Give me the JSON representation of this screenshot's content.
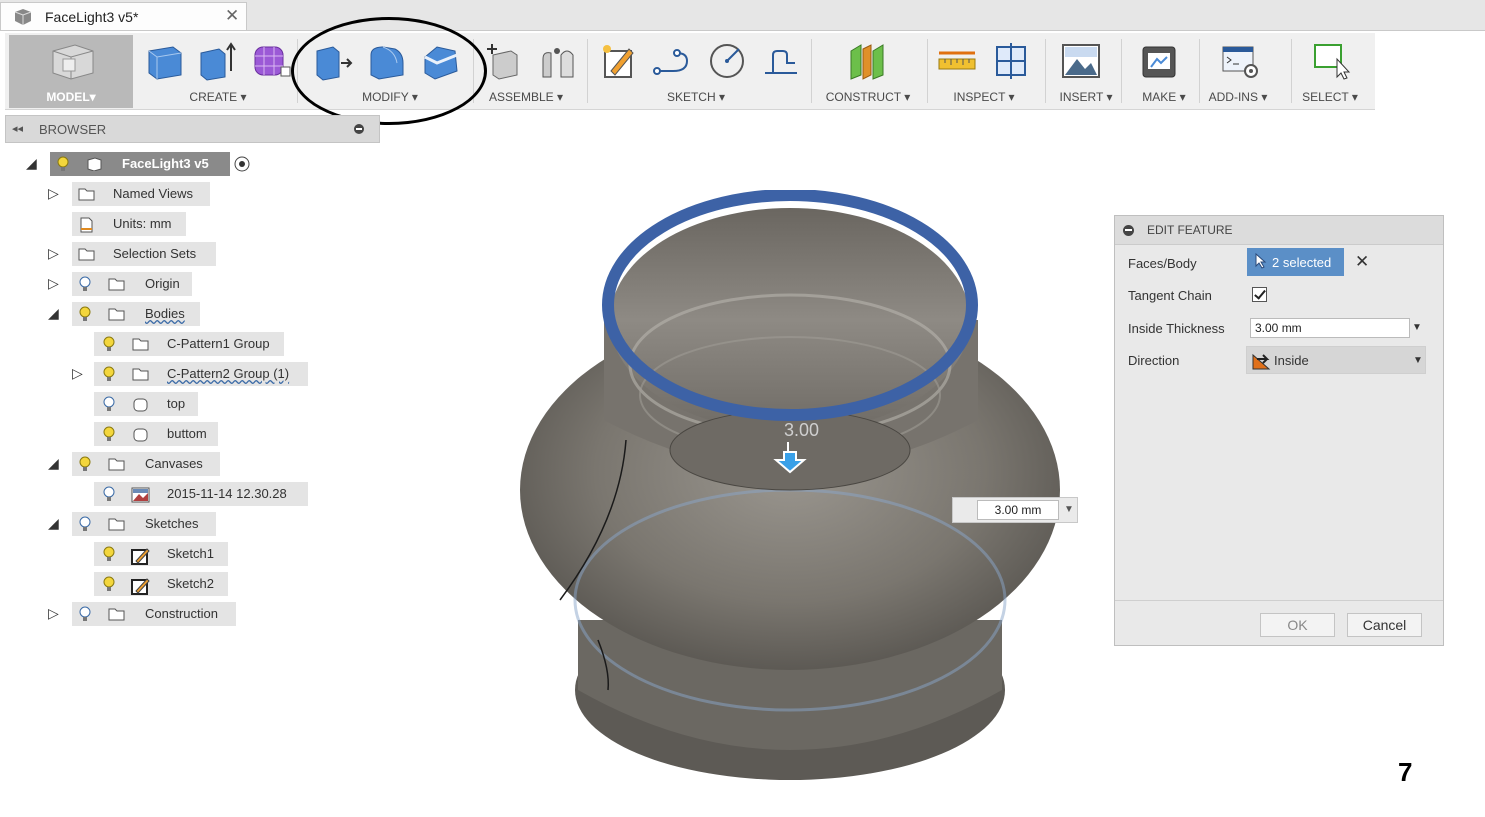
{
  "tab": {
    "title": "FaceLight3 v5*",
    "close": "✕"
  },
  "toolbar": {
    "workspace": "MODEL",
    "groups": {
      "create": "CREATE",
      "modify": "MODIFY",
      "assemble": "ASSEMBLE",
      "sketch": "SKETCH",
      "construct": "CONSTRUCT",
      "inspect": "INSPECT",
      "insert": "INSERT",
      "make": "MAKE",
      "addins": "ADD-INS",
      "select": "SELECT"
    },
    "dropdown_arrow": "▾"
  },
  "browser": {
    "title": "BROWSER",
    "collapse": "◂◂",
    "items": [
      {
        "label": "FaceLight3 v5"
      },
      {
        "label": "Named Views"
      },
      {
        "label": "Units: mm"
      },
      {
        "label": "Selection Sets"
      },
      {
        "label": "Origin"
      },
      {
        "label": "Bodies"
      },
      {
        "label": "C-Pattern1 Group"
      },
      {
        "label": "C-Pattern2 Group (1)"
      },
      {
        "label": "top"
      },
      {
        "label": "buttom"
      },
      {
        "label": "Canvases"
      },
      {
        "label": "2015-11-14 12.30.28"
      },
      {
        "label": "Sketches"
      },
      {
        "label": "Sketch1"
      },
      {
        "label": "Sketch2"
      },
      {
        "label": "Construction"
      }
    ]
  },
  "viewport": {
    "dimension_label": "3.00",
    "dimension_input": "3.00 mm"
  },
  "edit_feature": {
    "title": "EDIT FEATURE",
    "faces_label": "Faces/Body",
    "faces_value": "2 selected",
    "tangent_label": "Tangent Chain",
    "tangent_checked": true,
    "thickness_label": "Inside Thickness",
    "thickness_value": "3.00 mm",
    "direction_label": "Direction",
    "direction_value": "Inside",
    "ok": "OK",
    "cancel": "Cancel"
  },
  "annotation": {
    "page_number": "7"
  },
  "colors": {
    "accent": "#5b8fc7",
    "ring": "#3d62a6",
    "body": "#77736d"
  }
}
